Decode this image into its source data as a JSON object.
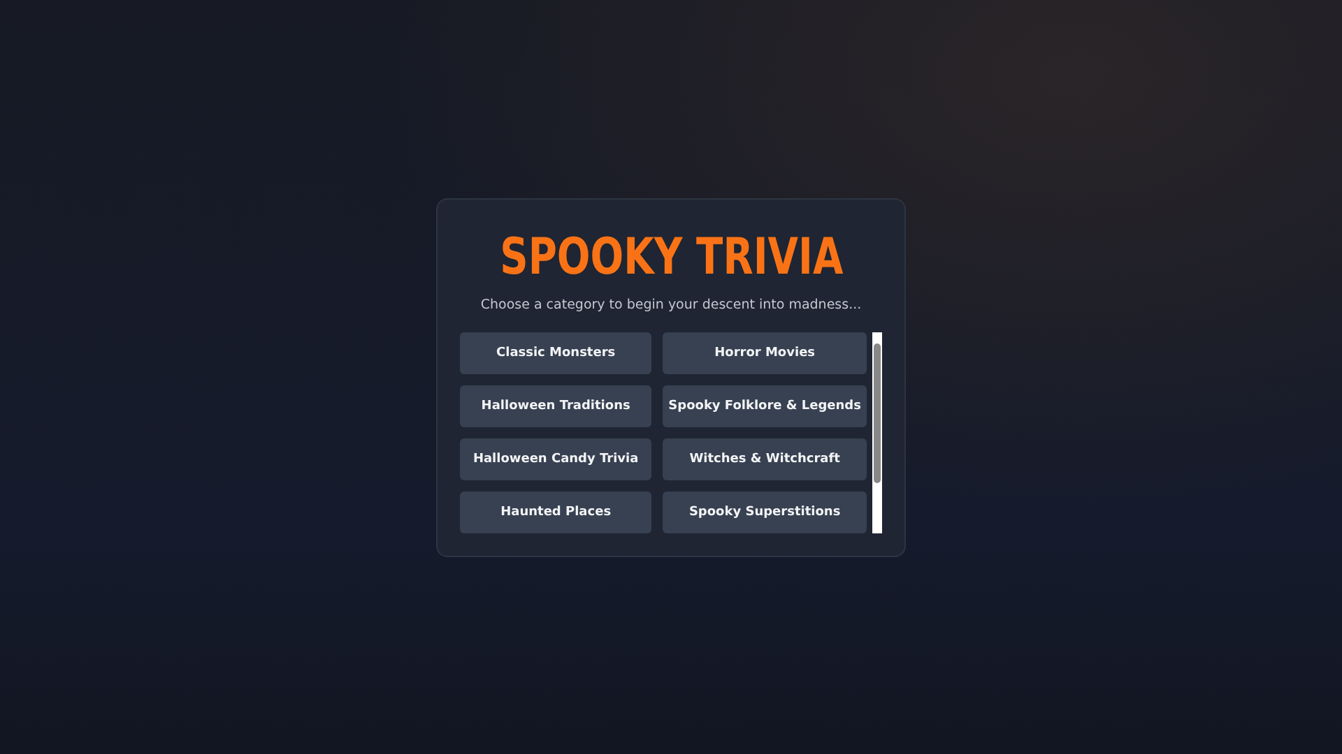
{
  "title": "SPOOKY TRIVIA",
  "subtitle": "Choose a category to begin your descent into madness...",
  "categories": [
    "Classic Monsters",
    "Horror Movies",
    "Halloween Traditions",
    "Spooky Folklore & Legends",
    "Halloween Candy Trivia",
    "Witches & Witchcraft",
    "Haunted Places",
    "Spooky Superstitions"
  ]
}
